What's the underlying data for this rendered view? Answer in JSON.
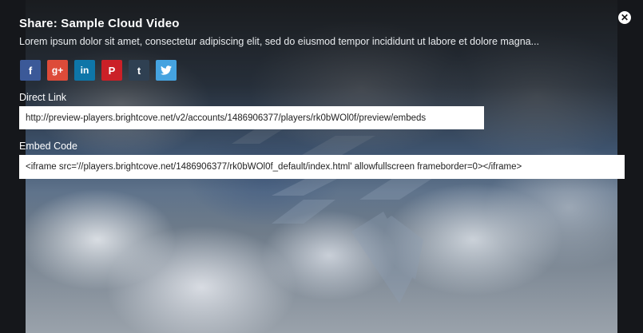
{
  "share": {
    "title": "Share: Sample Cloud Video",
    "description": "Lorem ipsum dolor sit amet, consectetur adipiscing elit, sed do eiusmod tempor incididunt ut labore et dolore magna..."
  },
  "close": {
    "glyph": "✕"
  },
  "social": [
    {
      "name": "facebook",
      "glyph": "f",
      "color": "#3b5998"
    },
    {
      "name": "google-plus",
      "glyph": "g+",
      "color": "#dd4b39"
    },
    {
      "name": "linkedin",
      "glyph": "in",
      "color": "#0e76a8"
    },
    {
      "name": "pinterest",
      "glyph": "P",
      "color": "#cb2027"
    },
    {
      "name": "tumblr",
      "glyph": "t",
      "color": "#2f4052"
    },
    {
      "name": "twitter",
      "glyph": "🐦",
      "color": "#45a3e0"
    }
  ],
  "direct_link": {
    "label": "Direct Link",
    "value": "http://preview-players.brightcove.net/v2/accounts/1486906377/players/rk0bWOl0f/preview/embeds"
  },
  "embed_code": {
    "label": "Embed Code",
    "value": "<iframe src='//players.brightcove.net/1486906377/rk0bWOl0f_default/index.html' allowfullscreen frameborder=0></iframe>"
  }
}
